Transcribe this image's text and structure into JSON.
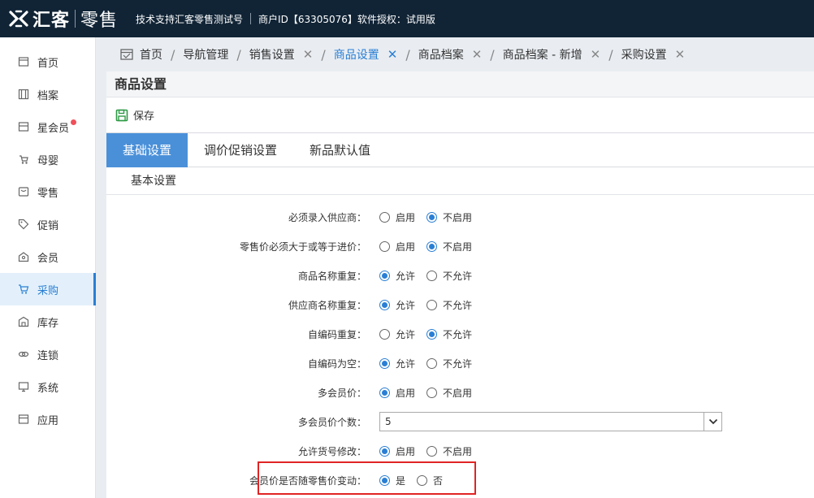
{
  "header": {
    "brand": "汇客",
    "product": "零售",
    "support": "技术支持汇客零售测试号",
    "merchant": "商户ID【63305076】软件授权：试用版"
  },
  "sidebar": {
    "items": [
      {
        "label": "首页",
        "icon": "home-icon"
      },
      {
        "label": "档案",
        "icon": "archive-icon"
      },
      {
        "label": "星会员",
        "icon": "star-member-icon",
        "badge": true
      },
      {
        "label": "母婴",
        "icon": "baby-stroller-icon"
      },
      {
        "label": "零售",
        "icon": "retail-box-icon"
      },
      {
        "label": "促销",
        "icon": "tag-icon"
      },
      {
        "label": "会员",
        "icon": "member-icon"
      },
      {
        "label": "采购",
        "icon": "cart-icon",
        "active": true
      },
      {
        "label": "库存",
        "icon": "warehouse-icon"
      },
      {
        "label": "连锁",
        "icon": "chain-icon"
      },
      {
        "label": "系统",
        "icon": "monitor-icon"
      },
      {
        "label": "应用",
        "icon": "apps-icon"
      }
    ]
  },
  "tabs": [
    {
      "label": "首页",
      "closable": false
    },
    {
      "label": "导航管理",
      "closable": false
    },
    {
      "label": "销售设置",
      "closable": true
    },
    {
      "label": "商品设置",
      "closable": true,
      "active": true
    },
    {
      "label": "商品档案",
      "closable": true
    },
    {
      "label": "商品档案 - 新增",
      "closable": true
    },
    {
      "label": "采购设置",
      "closable": true
    }
  ],
  "panel": {
    "title": "商品设置",
    "save_label": "保存",
    "subtabs": [
      "基础设置",
      "调价促销设置",
      "新品默认值"
    ],
    "section": "基本设置"
  },
  "form": {
    "rows": [
      {
        "label": "必须录入供应商：",
        "options": [
          "启用",
          "不启用"
        ],
        "selected": 1
      },
      {
        "label": "零售价必须大于或等于进价：",
        "options": [
          "启用",
          "不启用"
        ],
        "selected": 1
      },
      {
        "label": "商品名称重复：",
        "options": [
          "允许",
          "不允许"
        ],
        "selected": 0
      },
      {
        "label": "供应商名称重复：",
        "options": [
          "允许",
          "不允许"
        ],
        "selected": 0
      },
      {
        "label": "自编码重复：",
        "options": [
          "允许",
          "不允许"
        ],
        "selected": 1
      },
      {
        "label": "自编码为空：",
        "options": [
          "允许",
          "不允许"
        ],
        "selected": 0
      },
      {
        "label": "多会员价：",
        "options": [
          "启用",
          "不启用"
        ],
        "selected": 0
      },
      {
        "label": "多会员价个数：",
        "select_value": "5"
      },
      {
        "label": "允许货号修改：",
        "options": [
          "启用",
          "不启用"
        ],
        "selected": 0
      },
      {
        "label": "会员价是否随零售价变动：",
        "options": [
          "是",
          "否"
        ],
        "selected": 0
      }
    ]
  },
  "colors": {
    "topbar": "#112436",
    "accent": "#2a7fd4",
    "highlight": "#e02424",
    "save_icon": "#2d9a45"
  }
}
